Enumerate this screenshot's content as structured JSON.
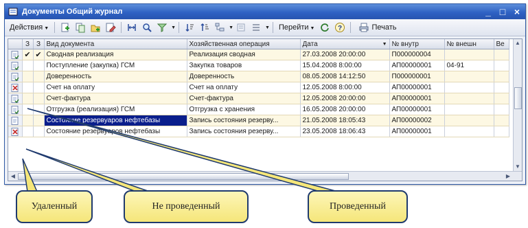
{
  "window": {
    "title": "Документы Общий журнал",
    "minimize": "_",
    "maximize": "□",
    "close": "×"
  },
  "toolbar": {
    "actions_label": "Действия",
    "goto_label": "Перейти",
    "help_label": "?",
    "print_label": "Печать",
    "icons": [
      "add-icon",
      "copy-icon",
      "add-group-icon",
      "edit-icon",
      "interval-icon",
      "find-icon",
      "filter-icon",
      "sort-ascending-icon",
      "sort-descending-icon",
      "hierarchy-icon",
      "structure-icon",
      "refresh-icon",
      "help-icon",
      "print-icon"
    ]
  },
  "grid": {
    "columns": [
      "",
      "З",
      "З",
      "Вид документа",
      "Хозяйственная операция",
      "Дата",
      "№ внутр",
      "№ внешн",
      "Ве"
    ],
    "rows": [
      {
        "status": "posted",
        "c1": "✔",
        "c2": "✔",
        "doc_type": "Сводная реализация",
        "operation": "Реализация сводная",
        "date": "27.03.2008 20:00:00",
        "num_int": "П000000004",
        "num_ext": "",
        "selected": false
      },
      {
        "status": "posted",
        "c1": "",
        "c2": "",
        "doc_type": "Поступление (закупка) ГСМ",
        "operation": "Закупка товаров",
        "date": "15.04.2008 8:00:00",
        "num_int": "АП00000001",
        "num_ext": "04-91",
        "selected": false
      },
      {
        "status": "posted",
        "c1": "",
        "c2": "",
        "doc_type": "Доверенность",
        "operation": "Доверенность",
        "date": "08.05.2008 14:12:50",
        "num_int": "П000000001",
        "num_ext": "",
        "selected": false
      },
      {
        "status": "deleted",
        "c1": "",
        "c2": "",
        "doc_type": "Счет на оплату",
        "operation": "Счет на оплату",
        "date": "12.05.2008 8:00:00",
        "num_int": "АП00000001",
        "num_ext": "",
        "selected": false
      },
      {
        "status": "posted",
        "c1": "",
        "c2": "",
        "doc_type": "Счет-фактура",
        "operation": "Счет-фактура",
        "date": "12.05.2008 20:00:00",
        "num_int": "АП00000001",
        "num_ext": "",
        "selected": false
      },
      {
        "status": "posted",
        "c1": "",
        "c2": "",
        "doc_type": "Отгрузка (реализация) ГСМ",
        "operation": "Отгрузка с хранения",
        "date": "16.05.2008 20:00:00",
        "num_int": "АП00000001",
        "num_ext": "",
        "selected": false
      },
      {
        "status": "not-posted",
        "c1": "",
        "c2": "",
        "doc_type": "Состояние резервуаров нефтебазы",
        "operation": "Запись состояния резерву...",
        "date": "21.05.2008 18:05:43",
        "num_int": "АП00000002",
        "num_ext": "",
        "selected": true
      },
      {
        "status": "deleted",
        "c1": "",
        "c2": "",
        "doc_type": "Состояние резервуаров нефтебазы",
        "operation": "Запись состояния резерву...",
        "date": "23.05.2008 18:06:43",
        "num_int": "АП00000001",
        "num_ext": "",
        "selected": false
      }
    ]
  },
  "callouts": {
    "deleted": "Удаленный",
    "not_posted": "Не проведенный",
    "posted": "Проведенный"
  },
  "colors": {
    "titlebar": "#2f62c4",
    "row_tint": "#fdf8e3",
    "selection": "#0a1e8c",
    "callout_fill": "#f5e67a",
    "callout_border": "#1f3a6e"
  }
}
